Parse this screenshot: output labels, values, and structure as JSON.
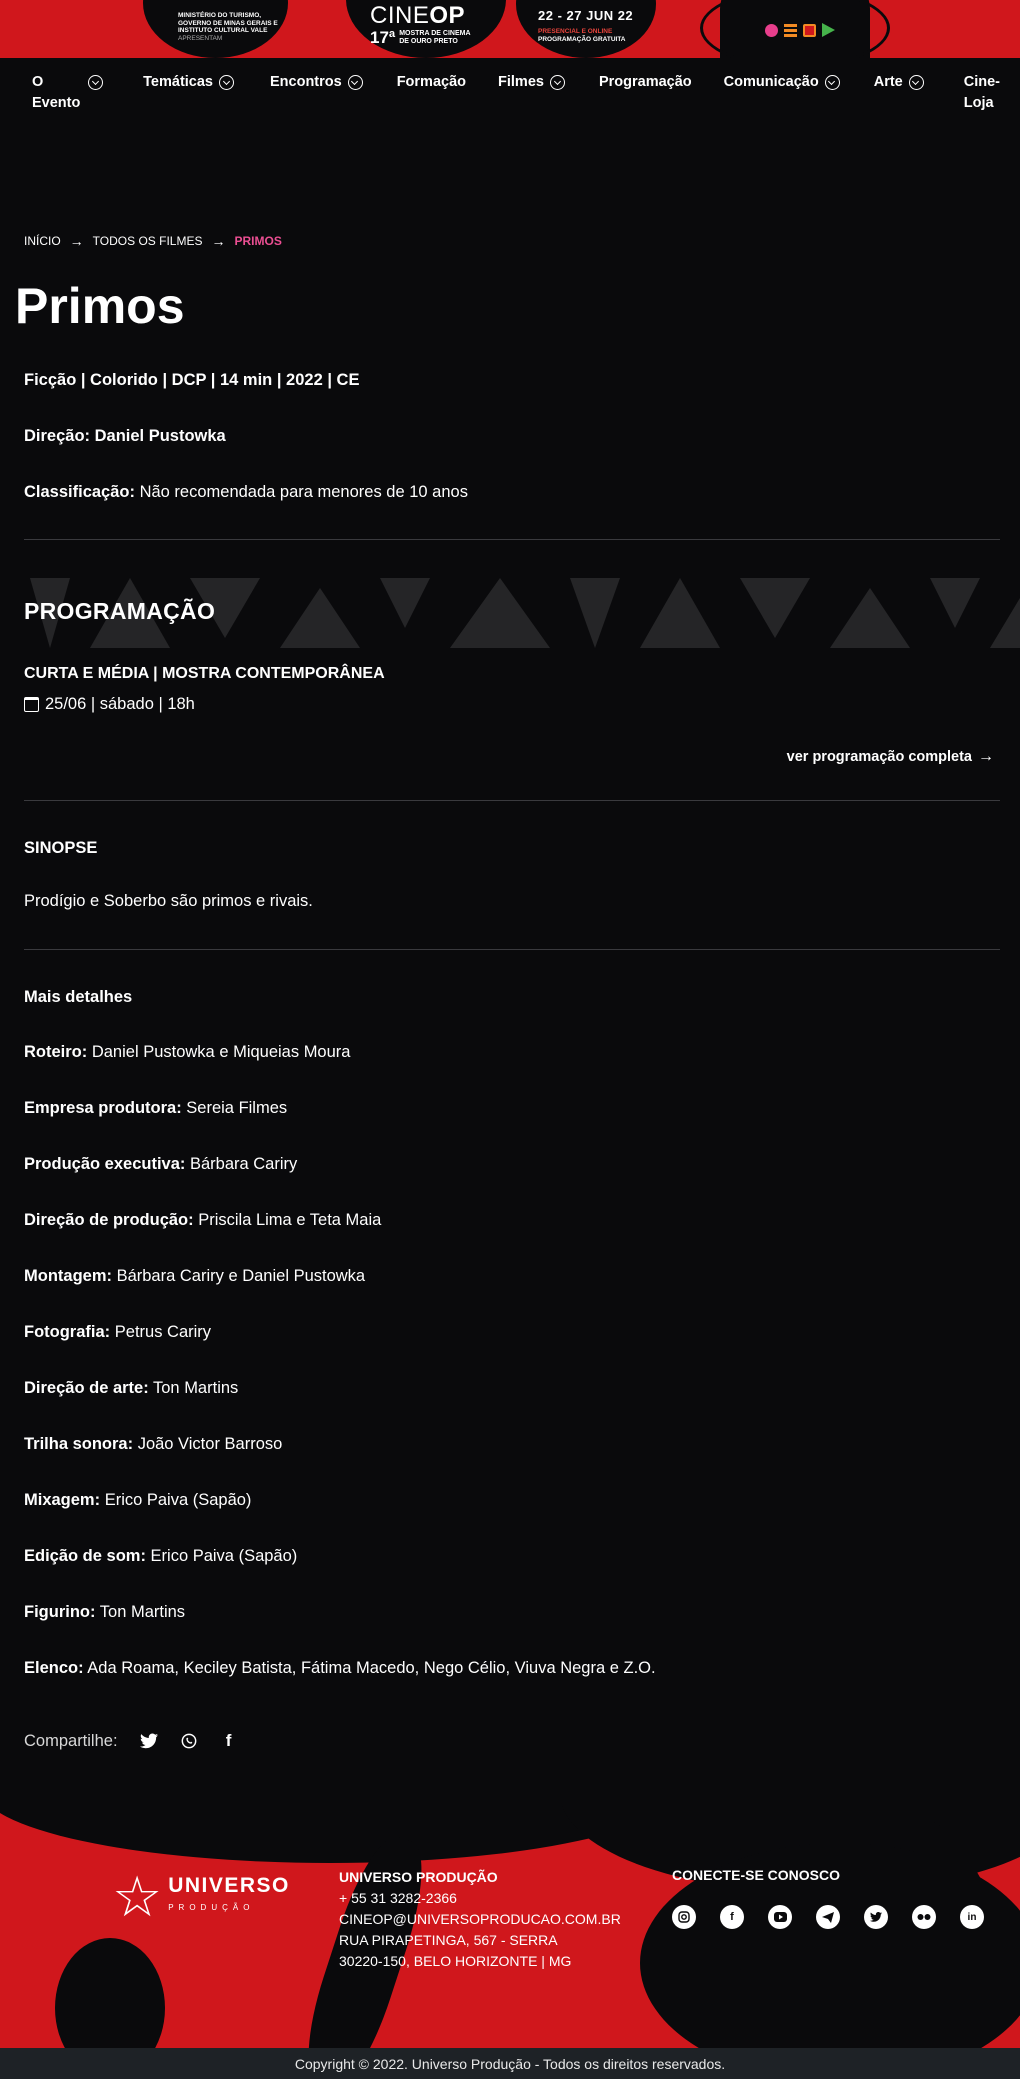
{
  "banner": {
    "ministry_lines": [
      "Ministério do Turismo,",
      "Governo de Minas Gerais e",
      "Instituto Cultural Vale"
    ],
    "presents": "Apresentam",
    "logo_light": "CINE",
    "logo_bold": "OP",
    "edition": "17ª",
    "edition_text_1": "Mostra de Cinema",
    "edition_text_2": "de Ouro Preto",
    "dates": "22 - 27 JUN 22",
    "dates_sub_1": "Presencial e Online",
    "dates_sub_2": "Programação Gratuita"
  },
  "nav": {
    "items": [
      {
        "label": "O Evento",
        "dropdown": true
      },
      {
        "label": "Temáticas",
        "dropdown": true
      },
      {
        "label": "Encontros",
        "dropdown": true
      },
      {
        "label": "Formação",
        "dropdown": false
      },
      {
        "label": "Filmes",
        "dropdown": true
      },
      {
        "label": "Programação",
        "dropdown": false
      },
      {
        "label": "Comunicação",
        "dropdown": true
      },
      {
        "label": "Arte",
        "dropdown": true
      },
      {
        "label": "Cine-Loja",
        "dropdown": false
      }
    ]
  },
  "breadcrumb": {
    "home": "INÍCIO",
    "films": "TODOS OS FILMES",
    "current": "PRIMOS"
  },
  "film": {
    "title": "Primos",
    "specs": "Ficção | Colorido | DCP | 14 min | 2022 | CE",
    "director": "Direção: Daniel Pustowka",
    "rating_label": "Classificação:",
    "rating_value": " Não recomendada para menores de 10 anos"
  },
  "programacao": {
    "heading": "PROGRAMAÇÃO",
    "session_title": "CURTA E MÉDIA | MOSTRA CONTEMPORÂNEA",
    "session_date": "25/06 | sábado | 18h",
    "full_link": "ver programação completa"
  },
  "sinopse": {
    "heading": "SINOPSE",
    "text": "Prodígio e Soberbo são primos e rivais."
  },
  "details": {
    "heading": "Mais detalhes",
    "rows": [
      {
        "label": "Roteiro:",
        "value": " Daniel Pustowka e Miqueias Moura"
      },
      {
        "label": "Empresa produtora:",
        "value": " Sereia Filmes"
      },
      {
        "label": "Produção executiva:",
        "value": " Bárbara Cariry"
      },
      {
        "label": "Direção de produção:",
        "value": " Priscila Lima e Teta Maia"
      },
      {
        "label": "Montagem:",
        "value": " Bárbara Cariry e Daniel Pustowka"
      },
      {
        "label": "Fotografia:",
        "value": " Petrus Cariry"
      },
      {
        "label": "Direção de arte:",
        "value": " Ton Martins"
      },
      {
        "label": "Trilha sonora:",
        "value": " João Victor Barroso"
      },
      {
        "label": "Mixagem:",
        "value": " Erico Paiva (Sapão)"
      },
      {
        "label": "Edição de som:",
        "value": " Erico Paiva (Sapão)"
      },
      {
        "label": "Figurino:",
        "value": " Ton Martins"
      },
      {
        "label": "Elenco:",
        "value": " Ada Roama, Keciley Batista, Fátima Macedo, Nego Célio, Viuva Negra e Z.O."
      }
    ]
  },
  "share": {
    "label": "Compartilhe:",
    "icons": [
      "twitter-icon",
      "whatsapp-icon",
      "facebook-icon"
    ]
  },
  "footer": {
    "logo_name": "UNIVERSO",
    "logo_sub": "PRODUÇÃO",
    "company": "UNIVERSO PRODUÇÃO",
    "phone": "+ 55 31 3282-2366",
    "email": "CINEOP@UNIVERSOPRODUCAO.COM.BR",
    "address_1": "RUA PIRAPETINGA, 567 - SERRA",
    "address_2": "30220-150, BELO HORIZONTE | MG",
    "social_title": "CONECTE-SE CONOSCO",
    "social_icons": [
      "instagram-icon",
      "facebook-icon",
      "youtube-icon",
      "telegram-icon",
      "twitter-icon",
      "flickr-icon",
      "linkedin-icon"
    ],
    "copyright": "Copyright © 2022. Universo Produção - Todos os direitos reservados."
  },
  "colors": {
    "brand_red": "#d0171c",
    "accent_pink": "#ec4f93",
    "background": "#0a0a0c"
  }
}
